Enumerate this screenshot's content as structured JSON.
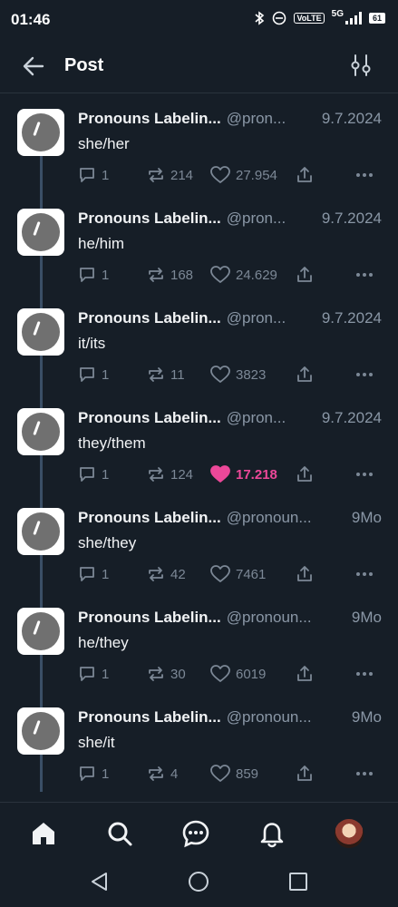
{
  "status_bar": {
    "time": "01:46",
    "network_label": "5G",
    "volte_label": "VoLTE",
    "battery": "61"
  },
  "header": {
    "title": "Post"
  },
  "posts": [
    {
      "author": "Pronouns Labelin...",
      "handle": "@pron...",
      "date": "9.7.2024",
      "text": "she/her",
      "replies": "1",
      "reposts": "214",
      "likes": "27.954",
      "liked": false
    },
    {
      "author": "Pronouns Labelin...",
      "handle": "@pron...",
      "date": "9.7.2024",
      "text": "he/him",
      "replies": "1",
      "reposts": "168",
      "likes": "24.629",
      "liked": false
    },
    {
      "author": "Pronouns Labelin...",
      "handle": "@pron...",
      "date": "9.7.2024",
      "text": "it/its",
      "replies": "1",
      "reposts": "11",
      "likes": "3823",
      "liked": false
    },
    {
      "author": "Pronouns Labelin...",
      "handle": "@pron...",
      "date": "9.7.2024",
      "text": "they/them",
      "replies": "1",
      "reposts": "124",
      "likes": "17.218",
      "liked": true
    },
    {
      "author": "Pronouns Labelin...",
      "handle": "@pronoun...",
      "date": "9Mo",
      "text": "she/they",
      "replies": "1",
      "reposts": "42",
      "likes": "7461",
      "liked": false
    },
    {
      "author": "Pronouns Labelin...",
      "handle": "@pronoun...",
      "date": "9Mo",
      "text": "he/they",
      "replies": "1",
      "reposts": "30",
      "likes": "6019",
      "liked": false
    },
    {
      "author": "Pronouns Labelin...",
      "handle": "@pronoun...",
      "date": "9Mo",
      "text": "she/it",
      "replies": "1",
      "reposts": "4",
      "likes": "859",
      "liked": false
    }
  ],
  "icons": {
    "back": "arrow-left-icon",
    "filter": "sliders-icon",
    "reply": "comment-icon",
    "repost": "repost-icon",
    "like": "heart-icon",
    "share": "share-icon",
    "more": "more-dots-icon",
    "home": "home-icon",
    "search": "search-icon",
    "chat": "chat-icon",
    "notifications": "bell-icon"
  },
  "colors": {
    "background": "#161e27",
    "liked": "#ec4899",
    "muted": "#7c8896",
    "thread_line": "#3a4f66"
  }
}
